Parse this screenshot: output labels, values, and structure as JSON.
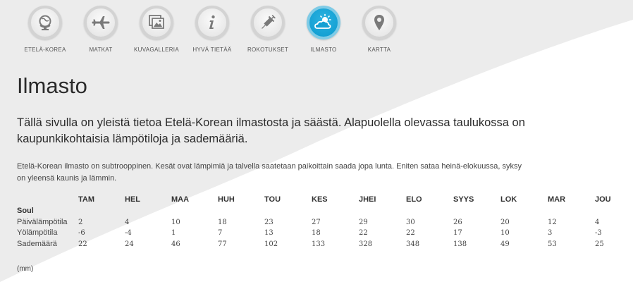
{
  "nav": [
    {
      "label": "ETELÄ-KOREA",
      "icon": "globe-icon"
    },
    {
      "label": "MATKAT",
      "icon": "airplane-icon"
    },
    {
      "label": "KUVAGALLERIA",
      "icon": "gallery-icon"
    },
    {
      "label": "HYVÄ TIETÄÄ",
      "icon": "info-icon"
    },
    {
      "label": "ROKOTUKSET",
      "icon": "syringe-icon"
    },
    {
      "label": "ILMASTO",
      "icon": "weather-icon",
      "active": true
    },
    {
      "label": "KARTTA",
      "icon": "map-pin-icon"
    }
  ],
  "colors": {
    "accent": "#14a0d3",
    "background": "#ececec",
    "wave": "#ffffff"
  },
  "page": {
    "title": "Ilmasto",
    "lead": "Tällä sivulla on yleistä tietoa Etelä-Korean ilmastosta ja säästä. Alapuolella olevassa taulukossa on kaupunkikohtaisia lämpötiloja ja sademääriä.",
    "body": "Etelä-Korean ilmasto on subtrooppinen. Kesät ovat lämpimiä ja talvella saatetaan paikoittain saada jopa lunta. Eniten sataa heinä-elokuussa, syksy on yleensä kaunis ja lämmin."
  },
  "climate_table": {
    "months": [
      "TAM",
      "HEL",
      "MAA",
      "HUH",
      "TOU",
      "KES",
      "JHEI",
      "ELO",
      "SYYS",
      "LOK",
      "MAR",
      "JOU"
    ],
    "city": "Soul",
    "rows": [
      {
        "label": "Päivälämpötila",
        "values": [
          "2",
          "4",
          "10",
          "18",
          "23",
          "27",
          "29",
          "30",
          "26",
          "20",
          "12",
          "4"
        ]
      },
      {
        "label": "Yölämpötila",
        "values": [
          "-6",
          "-4",
          "1",
          "7",
          "13",
          "18",
          "22",
          "22",
          "17",
          "10",
          "3",
          "-3"
        ]
      },
      {
        "label": "Sademäärä",
        "values": [
          "22",
          "24",
          "46",
          "77",
          "102",
          "133",
          "328",
          "348",
          "138",
          "49",
          "53",
          "25"
        ]
      }
    ],
    "unit_note": "(mm)"
  }
}
